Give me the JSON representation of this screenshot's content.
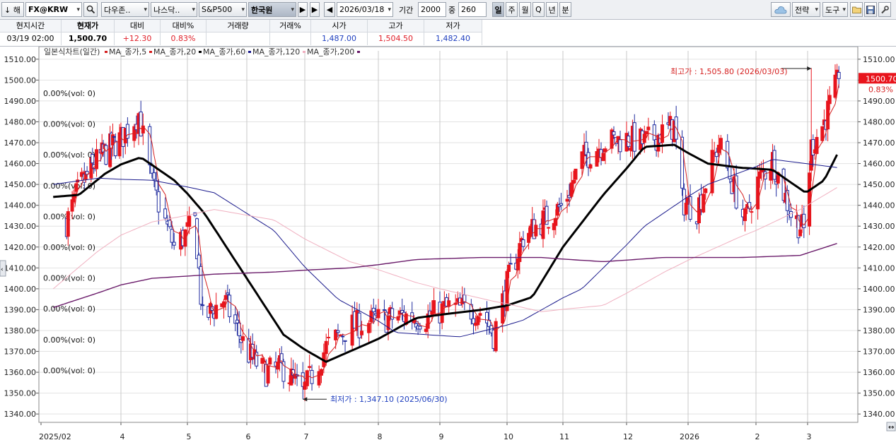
{
  "toolbar": {
    "nav_label": "↓ 해",
    "symbol": "FX@KRW",
    "dd1": "다우존..",
    "dd2": "나스닥..",
    "dd3": "S&P500",
    "dd4": "한국원",
    "date": "2026/03/18",
    "period_label": "기간",
    "period_value": "2000",
    "overlap_label": "중",
    "overlap_value": "260",
    "intervals": [
      "일",
      "주",
      "월",
      "Q",
      "년",
      "분"
    ],
    "strategy_label": "전략",
    "tools_label": "도구"
  },
  "quote": {
    "headers": [
      "현지시간",
      "현재가",
      "대비",
      "대비%",
      "거래량",
      "거래%",
      "시가",
      "고가",
      "저가"
    ],
    "time": "03/19 02:00",
    "price": "1,500.70",
    "change": "+12.30",
    "change_pct": "0.83%",
    "volume": "",
    "volume_pct": "",
    "open": "1,487.00",
    "high": "1,504.50",
    "low": "1,482.40"
  },
  "chart": {
    "title": "일본식차트(일간)",
    "legend": [
      {
        "label": "MA_종가,5",
        "color": "#d52020"
      },
      {
        "label": "MA_종가,20",
        "color": "#d52020"
      },
      {
        "label": "MA_종가,60",
        "color": "#000000"
      },
      {
        "label": "MA_종가,120",
        "color": "#1a1a8c"
      },
      {
        "label": "MA_종가,200",
        "color": "#f0b0c0"
      },
      {
        "label": "",
        "color": "#6a1b6a"
      }
    ],
    "vol_labels": [
      "0.00%(vol: 0)",
      "0.00%(vol: 0)",
      "0.00%(vol: 0)",
      "0.00%(vol: 0)",
      "0.00%(vol: 0)",
      "0.00%(vol: 0)",
      "0.00%(vol: 0)",
      "0.00%(vol: 0)",
      "0.00%(vol: 0)",
      "0.00%(vol: 0)"
    ],
    "high_annotation": "최고가 : 1,505.80 (2026/03/03)",
    "low_annotation": "최저가 : 1,347.10 (2025/06/30)",
    "last_price_tag": "1500.70",
    "last_pct_tag": "0.83%",
    "colors": {
      "up": "#e8141c",
      "down": "#1e2a9e",
      "grid": "#c8c8c8"
    }
  },
  "chart_data": {
    "type": "candlestick",
    "title": "일본식차트(일간)",
    "y_ticks": [
      1510,
      1500,
      1490,
      1480,
      1470,
      1460,
      1450,
      1440,
      1430,
      1420,
      1410,
      1400,
      1390,
      1380,
      1370,
      1360,
      1350,
      1340
    ],
    "ylim": [
      1336,
      1514
    ],
    "x_ticks": [
      "2025/02",
      "4",
      "5",
      "6",
      "7",
      "8",
      "9",
      "10",
      "11",
      "12",
      "2026",
      "2",
      "3"
    ],
    "price_path": [
      [
        "2025-02-20",
        1432
      ],
      [
        "2025-03-01",
        1448
      ],
      [
        "2025-03-15",
        1462
      ],
      [
        "2025-04-01",
        1472
      ],
      [
        "2025-04-09",
        1484
      ],
      [
        "2025-04-15",
        1450
      ],
      [
        "2025-04-25",
        1420
      ],
      [
        "2025-05-05",
        1432
      ],
      [
        "2025-05-09",
        1385
      ],
      [
        "2025-05-20",
        1395
      ],
      [
        "2025-06-01",
        1370
      ],
      [
        "2025-06-10",
        1360
      ],
      [
        "2025-06-20",
        1362
      ],
      [
        "2025-06-30",
        1350
      ],
      [
        "2025-07-10",
        1372
      ],
      [
        "2025-07-20",
        1382
      ],
      [
        "2025-08-01",
        1385
      ],
      [
        "2025-08-15",
        1387
      ],
      [
        "2025-08-25",
        1386
      ],
      [
        "2025-09-05",
        1391
      ],
      [
        "2025-09-20",
        1389
      ],
      [
        "2025-09-25",
        1378
      ],
      [
        "2025-10-01",
        1402
      ],
      [
        "2025-10-10",
        1425
      ],
      [
        "2025-10-20",
        1432
      ],
      [
        "2025-11-01",
        1440
      ],
      [
        "2025-11-10",
        1462
      ],
      [
        "2025-11-20",
        1470
      ],
      [
        "2025-12-01",
        1472
      ],
      [
        "2025-12-10",
        1470
      ],
      [
        "2025-12-25",
        1478
      ],
      [
        "2025-12-29",
        1442
      ],
      [
        "2026-01-05",
        1438
      ],
      [
        "2026-01-15",
        1470
      ],
      [
        "2026-01-27",
        1432
      ],
      [
        "2026-02-01",
        1450
      ],
      [
        "2026-02-10",
        1462
      ],
      [
        "2026-02-20",
        1436
      ],
      [
        "2026-02-27",
        1428
      ],
      [
        "2026-03-03",
        1468
      ],
      [
        "2026-03-10",
        1480
      ],
      [
        "2026-03-18",
        1500.7
      ]
    ],
    "ma5_color": "#d52020",
    "series": [
      {
        "name": "MA_종가,60",
        "color": "#000000",
        "points": [
          [
            "2025-02-10",
            1444
          ],
          [
            "2025-03-01",
            1445
          ],
          [
            "2025-03-20",
            1455
          ],
          [
            "2025-04-10",
            1463
          ],
          [
            "2025-04-25",
            1452
          ],
          [
            "2025-05-10",
            1436
          ],
          [
            "2025-06-01",
            1405
          ],
          [
            "2025-06-20",
            1378
          ],
          [
            "2025-07-10",
            1365
          ],
          [
            "2025-08-01",
            1376
          ],
          [
            "2025-08-20",
            1386
          ],
          [
            "2025-09-20",
            1390
          ],
          [
            "2025-10-01",
            1392
          ],
          [
            "2025-10-15",
            1396
          ],
          [
            "2025-11-01",
            1420
          ],
          [
            "2025-11-20",
            1445
          ],
          [
            "2025-12-10",
            1468
          ],
          [
            "2025-12-25",
            1469
          ],
          [
            "2026-01-10",
            1460
          ],
          [
            "2026-01-25",
            1458
          ],
          [
            "2026-02-10",
            1457
          ],
          [
            "2026-02-28",
            1446
          ],
          [
            "2026-03-10",
            1452
          ],
          [
            "2026-03-18",
            1466
          ]
        ]
      },
      {
        "name": "MA_종가,120",
        "color": "#1a1a8c",
        "points": [
          [
            "2025-02-10",
            1450
          ],
          [
            "2025-03-15",
            1453
          ],
          [
            "2025-04-15",
            1452
          ],
          [
            "2025-05-15",
            1446
          ],
          [
            "2025-06-15",
            1428
          ],
          [
            "2025-07-15",
            1395
          ],
          [
            "2025-08-10",
            1379
          ],
          [
            "2025-09-10",
            1377
          ],
          [
            "2025-10-10",
            1385
          ],
          [
            "2025-11-10",
            1400
          ],
          [
            "2025-12-10",
            1430
          ],
          [
            "2026-01-10",
            1450
          ],
          [
            "2026-02-10",
            1462
          ],
          [
            "2026-03-18",
            1458
          ]
        ]
      },
      {
        "name": "MA_종가,200",
        "color": "#f0b0c0",
        "points": [
          [
            "2025-02-10",
            1400
          ],
          [
            "2025-03-15",
            1418
          ],
          [
            "2025-04-15",
            1432
          ],
          [
            "2025-05-15",
            1438
          ],
          [
            "2025-06-15",
            1433
          ],
          [
            "2025-07-20",
            1413
          ],
          [
            "2025-08-20",
            1403
          ],
          [
            "2025-09-25",
            1394
          ],
          [
            "2025-10-20",
            1389
          ],
          [
            "2025-11-20",
            1392
          ],
          [
            "2025-12-20",
            1408
          ],
          [
            "2026-01-25",
            1425
          ],
          [
            "2026-02-25",
            1438
          ],
          [
            "2026-03-18",
            1449
          ]
        ]
      },
      {
        "name": "",
        "color": "#6a1b6a",
        "points": [
          [
            "2025-02-10",
            1391
          ],
          [
            "2025-03-15",
            1398
          ],
          [
            "2025-04-15",
            1405
          ],
          [
            "2025-05-15",
            1407
          ],
          [
            "2025-06-15",
            1408
          ],
          [
            "2025-07-20",
            1410
          ],
          [
            "2025-08-20",
            1414
          ],
          [
            "2025-09-20",
            1415
          ],
          [
            "2025-10-20",
            1415
          ],
          [
            "2025-11-20",
            1413
          ],
          [
            "2025-12-20",
            1415
          ],
          [
            "2026-01-25",
            1415
          ],
          [
            "2026-02-25",
            1416
          ],
          [
            "2026-03-18",
            1422
          ]
        ]
      }
    ],
    "high": {
      "date": "2026-03-03",
      "value": 1505.8
    },
    "low": {
      "date": "2025-06-30",
      "value": 1347.1
    },
    "last": 1500.7
  }
}
